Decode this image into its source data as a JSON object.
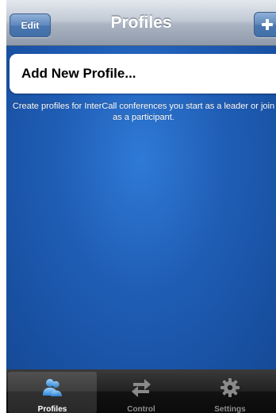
{
  "navbar": {
    "title": "Profiles",
    "edit_label": "Edit",
    "add_icon": "plus-icon"
  },
  "content": {
    "add_profile_label": "Add New Profile...",
    "info_text": "Create profiles for InterCall conferences you start as a leader or join as a participant."
  },
  "tabbar": {
    "tabs": [
      {
        "label": "Profiles",
        "icon": "people-icon",
        "selected": true
      },
      {
        "label": "Control",
        "icon": "arrows-icon",
        "selected": false
      },
      {
        "label": "Settings",
        "icon": "gear-icon",
        "selected": false
      }
    ]
  },
  "colors": {
    "background_blue": "#1d56a8",
    "button_blue": "#4a77b0",
    "tab_active_icon": "#4aa3e8"
  }
}
